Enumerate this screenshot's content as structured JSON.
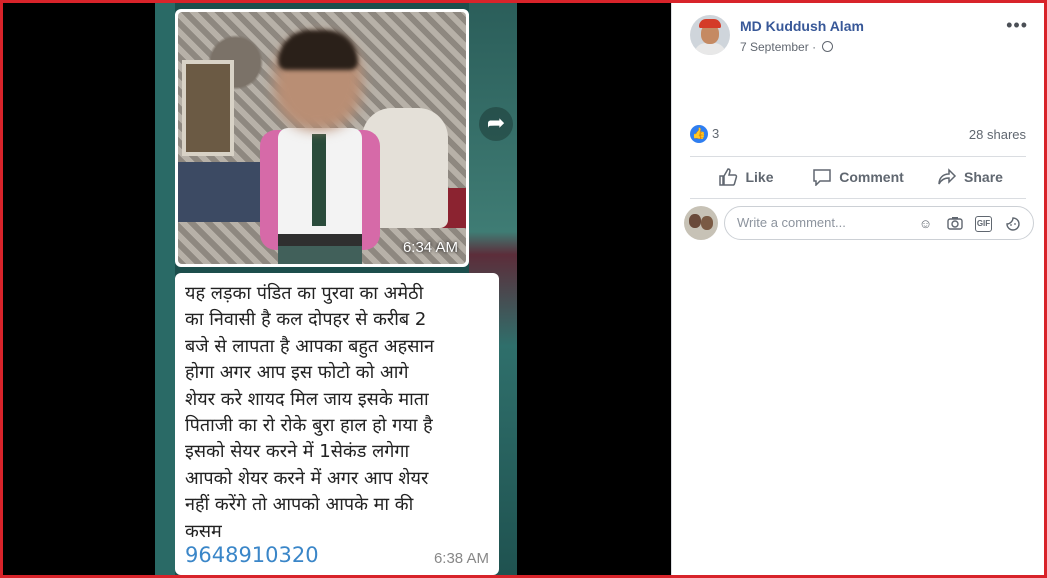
{
  "media": {
    "photo_timestamp": "6:34 AM",
    "message_text": "यह लड़का पंडित का पुरवा का  अमेठी\nका निवासी है कल दोपहर से करीब 2\nबजे से लापता है आपका बहुत अहसान\nहोगा अगर आप इस फोटो को  आगे\nशेयर करे शायद मिल जाय  इसके माता\nपिताजी का रो रोके बुरा हाल हो गया है\nइसको सेयर करने में 1सेकंड लगेगा\nआपको शेयर करने में अगर आप शेयर\nनहीं करेंगे तो आपको आपके मा की\nकसम",
    "phone_number": "9648910320",
    "message_timestamp": "6:38 AM"
  },
  "post": {
    "author": "MD Kuddush Alam",
    "date": "7 September",
    "reaction_count": "3",
    "shares": "28 shares"
  },
  "actions": {
    "like": "Like",
    "comment": "Comment",
    "share": "Share"
  },
  "comment_box": {
    "placeholder": "Write a comment..."
  },
  "colors": {
    "frame_border": "#d8232a",
    "author_link": "#385898",
    "like_blue": "#2f7ef0",
    "phone_link": "#3a86c8"
  }
}
